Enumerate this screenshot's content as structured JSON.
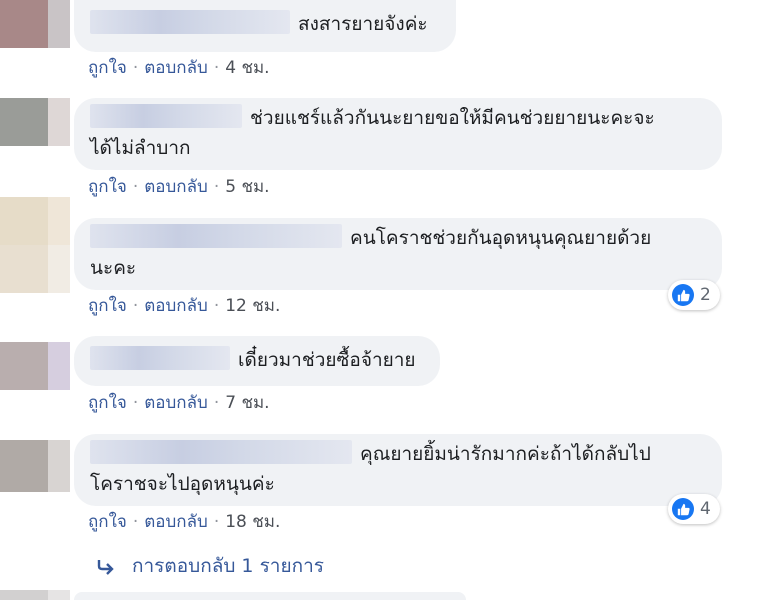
{
  "comments": [
    {
      "text": "สงสารยายจังค่ะ",
      "like_label": "ถูกใจ",
      "reply_label": "ตอบกลับ",
      "time": "4 ชม."
    },
    {
      "text_line1": "ช่วยแชร์แล้วกันนะยายขอให้มีคนช่วยยายนะคะจะ",
      "text_line2": "ได้ไม่ลำบาก",
      "like_label": "ถูกใจ",
      "reply_label": "ตอบกลับ",
      "time": "5 ชม."
    },
    {
      "text_line1": "คนโคราชช่วยกันอุดหนุนคุณยายด้วย",
      "text_line2": "นะคะ",
      "like_label": "ถูกใจ",
      "reply_label": "ตอบกลับ",
      "time": "12 ชม.",
      "reaction_count": "2"
    },
    {
      "text": "เดี๋ยวมาช่วยซื้อจ้ายาย",
      "like_label": "ถูกใจ",
      "reply_label": "ตอบกลับ",
      "time": "7 ชม."
    },
    {
      "text_line1": "คุณยายยิ้มน่ารักมากค่ะถ้าได้กลับไป",
      "text_line2": "โคราชจะไปอุดหนุนค่ะ",
      "like_label": "ถูกใจ",
      "reply_label": "ตอบกลับ",
      "time": "18 ชม.",
      "reaction_count": "4"
    }
  ],
  "view_replies": "การตอบกลับ 1 รายการ",
  "icons": {
    "reaction": "thumbs-up-icon",
    "reply_arrow": "reply-arrow-icon"
  },
  "colors": {
    "bubble": "#f0f2f5",
    "link": "#365899",
    "like_blue": "#1877f2"
  }
}
